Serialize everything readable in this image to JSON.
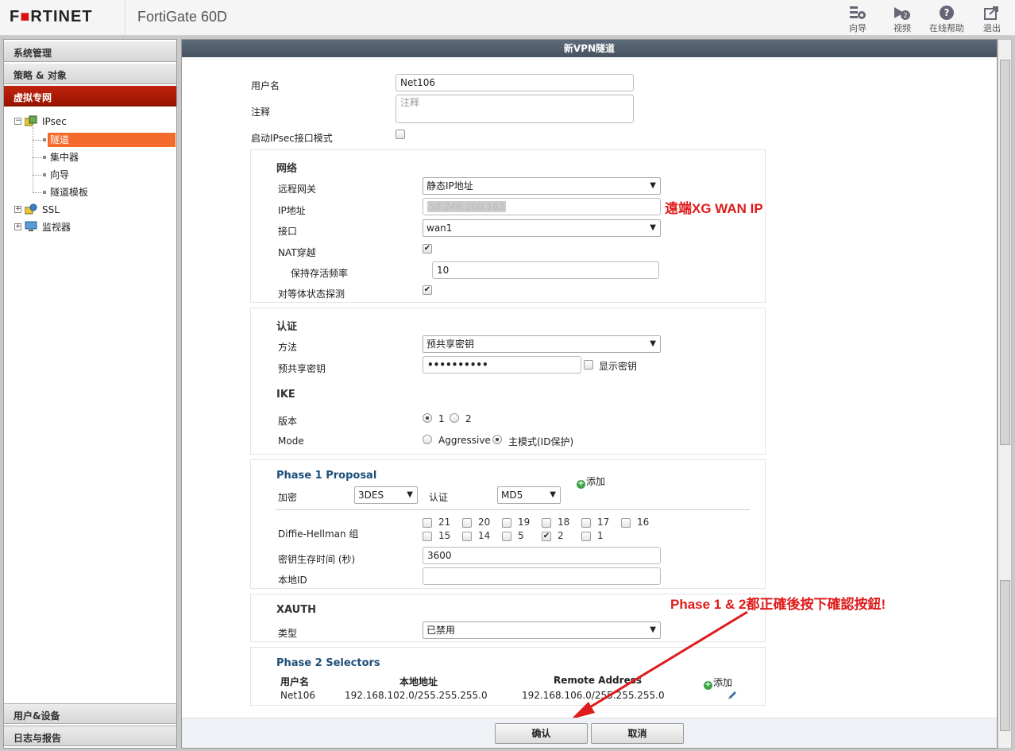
{
  "header": {
    "logo_prefix": "F",
    "logo_mark": "■",
    "logo_rest": "RTINET",
    "model": "FortiGate 60D",
    "buttons": [
      {
        "label": "向导",
        "icon": "wizard-icon"
      },
      {
        "label": "视频",
        "icon": "video-icon"
      },
      {
        "label": "在线帮助",
        "icon": "help-icon"
      },
      {
        "label": "退出",
        "icon": "logout-icon"
      }
    ]
  },
  "sidebar": {
    "sections": [
      "系统管理",
      "策略 & 对象",
      "虚拟专网"
    ],
    "bottom_sections": [
      "用户&设备",
      "日志与报告"
    ],
    "tree": {
      "ipsec": "IPsec",
      "ipsec_children": [
        "隧道",
        "集中器",
        "向导",
        "隧道模板"
      ],
      "ssl": "SSL",
      "monitor": "监视器"
    }
  },
  "form": {
    "title": "新VPN隧道",
    "name_label": "用户名",
    "name_value": "Net106",
    "comment_label": "注释",
    "comment_placeholder": "注释",
    "ipsec_mode_label": "启动IPsec接口模式",
    "network": {
      "title": "网络",
      "remote_gw_label": "远程网关",
      "remote_gw_value": "静态IP地址",
      "ip_label": "IP地址",
      "ip_value": "58.246.200.162",
      "interface_label": "接口",
      "interface_value": "wan1",
      "nat_label": "NAT穿越",
      "keepalive_label": "保持存活频率",
      "keepalive_value": "10",
      "dpd_label": "对等体状态探测"
    },
    "auth": {
      "title": "认证",
      "method_label": "方法",
      "method_value": "预共享密钥",
      "psk_label": "预共享密钥",
      "psk_value": "••••••••••",
      "show_psk_label": "显示密钥"
    },
    "ike": {
      "title": "IKE",
      "version_label": "版本",
      "version_1": "1",
      "version_2": "2",
      "mode_label": "Mode",
      "mode_aggressive": "Aggressive",
      "mode_main": "主模式(ID保护)"
    },
    "phase1": {
      "title": "Phase 1 Proposal",
      "add_label": "添加",
      "enc_label": "加密",
      "enc_value": "3DES",
      "auth_label": "认证",
      "auth_value": "MD5",
      "dh_label": "Diffie-Hellman 组",
      "dh_row1": [
        "21",
        "20",
        "19",
        "18",
        "17",
        "16"
      ],
      "dh_row2": [
        "15",
        "14",
        "5",
        "2",
        "1"
      ],
      "checked_group": "2",
      "keylife_label": "密钥生存时间 (秒)",
      "keylife_value": "3600",
      "localid_label": "本地ID",
      "localid_value": ""
    },
    "xauth": {
      "title": "XAUTH",
      "type_label": "类型",
      "type_value": "已禁用"
    },
    "phase2": {
      "title": "Phase 2 Selectors",
      "columns": [
        "用户名",
        "本地地址",
        "Remote Address"
      ],
      "add_label": "添加",
      "rows": [
        {
          "name": "Net106",
          "local": "192.168.102.0/255.255.255.0",
          "remote": "192.168.106.0/255.255.255.0",
          "edit_icon": "pencil-icon"
        }
      ]
    },
    "ok_label": "确认",
    "cancel_label": "取消"
  },
  "annotations": {
    "ip_note": "遠端XG WAN IP",
    "confirm_note": "Phase 1 & 2都正確後按下確認按鈕!",
    "color": "#e01b1b"
  }
}
